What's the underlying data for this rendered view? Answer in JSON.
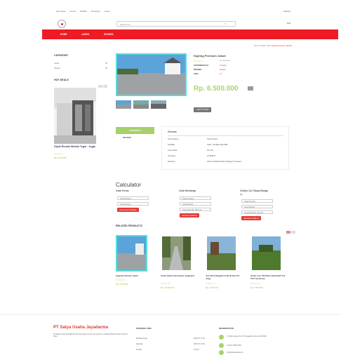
{
  "topnav": {
    "links": [
      "Akun Saya",
      "Favorit",
      "Wishlist",
      "Keranjang",
      "Logout"
    ],
    "language": "Bahasa"
  },
  "search": {
    "placeholder": "Search here",
    "cart_label": "IDR"
  },
  "navbar": {
    "items": [
      "HOME",
      "LANDS",
      "HOUSES"
    ]
  },
  "breadcrumb": {
    "home": "Home",
    "trail": [
      "Tanah",
      "Jual"
    ],
    "current": "Kapling Premium Jakarta"
  },
  "sidebar": {
    "category_title": "CATEGORY",
    "categories": [
      {
        "label": "Lands",
        "count": "18"
      },
      {
        "label": "Houses",
        "count": "20"
      }
    ],
    "hot_deals_title": "HOT DEALS",
    "hot_deal": {
      "title": "Dijual Rumah Mewah Tegal - Jogja",
      "rating": "★★★★☆",
      "price": "Rp. 8.000.000"
    }
  },
  "product": {
    "title": "Kapling Premium Jakart",
    "rating": "★★★★☆",
    "reviews": "(1) Review(s)",
    "meta": [
      {
        "label": "KETERSEDIAAN :",
        "value": "Tersedia"
      },
      {
        "label": "BRANDE :",
        "value": "Jakarta"
      },
      {
        "label": "SIAR :",
        "value": "44"
      }
    ],
    "price": "Rp. 6.500.000",
    "add_label": "ADD TO CART"
  },
  "tabs": {
    "description": "DESKRIPSI",
    "review": "REVIEW"
  },
  "spec": {
    "heading": "General",
    "rows": [
      {
        "k": "Tipe Property",
        "v": "Tipe Property"
      },
      {
        "k": "Sertifikat",
        "v": "SHM - Sertifikat Hak Milik"
      },
      {
        "k": "Luas Tanah",
        "v": "66 (m2)"
      },
      {
        "k": "ID Listing",
        "v": "PT4628 M"
      },
      {
        "k": "Deskripsi",
        "v": "Akses Terdekat Dekat Gerbang Tol Kanaro"
      }
    ]
  },
  "calculator": {
    "title": "Calculator",
    "cols": [
      {
        "heading": "Cash Keras",
        "inputs": [
          "Harga Property",
          "Uang Booking"
        ],
        "button": "Cash Keras Calculation"
      },
      {
        "heading": "Cash Bertahap",
        "inputs": [
          "Harga Property",
          "Uang Booking",
          "Uang Muka Min. 30% (%)"
        ],
        "button": "Calculate Installment"
      },
      {
        "heading": "Cicilan 12x Tanpa Bunga",
        "inputs": [
          "Harga Property",
          "Uang Booking",
          "Uang Muka Min. 30% (%)"
        ],
        "button": "Calculate Installment",
        "note": "Rp."
      }
    ]
  },
  "related": {
    "title": "RELATED PRODUCTS",
    "items": [
      {
        "title": "Kapling Premium Jakart",
        "rating": "★★★★☆",
        "price": "Rp. 6.500.000"
      },
      {
        "title": "Tanah Dalam Perumahan Jogjakarta",
        "rating": "★★★★☆",
        "price": "Rp. 13.000.000"
      },
      {
        "title": "Jual Tanah Ngaglik 10 Menit Dari UII Jogja",
        "rating": "★★★★☆",
        "price": "Rp. 4.400.000"
      },
      {
        "title": "Tanah Luas 350 Meter Dekat Mall The Park Semarang",
        "rating": "★★★★☆",
        "price": "Rp. 5.000.000"
      }
    ]
  },
  "footer": {
    "company": "PT Satya Usaha Jayadarma",
    "company_desc": "PT Satya Usaha Jayadarma is the best agent to find your property. Jual Beli Properti Tanah, Rumah, Ruko.",
    "hours_title": "OPENING TIME",
    "hours": [
      {
        "day": "Monday-Friday",
        "time": "08:00 To 17:00"
      },
      {
        "day": "Saturday",
        "time": "08:00 To 15:00"
      },
      {
        "day": "Sunday",
        "time": "Closed"
      }
    ],
    "info_title": "INFORMATION",
    "info": [
      "Jl. Sultan Agung No. 45 Yogyakarta, Indonesia 55166",
      "+62 877 8800 3300",
      "info@satyausaha.com"
    ]
  },
  "colors": {
    "red": "#ee1b24",
    "green": "#a8d36a",
    "teal": "#5dd",
    "star": "#ec3"
  }
}
